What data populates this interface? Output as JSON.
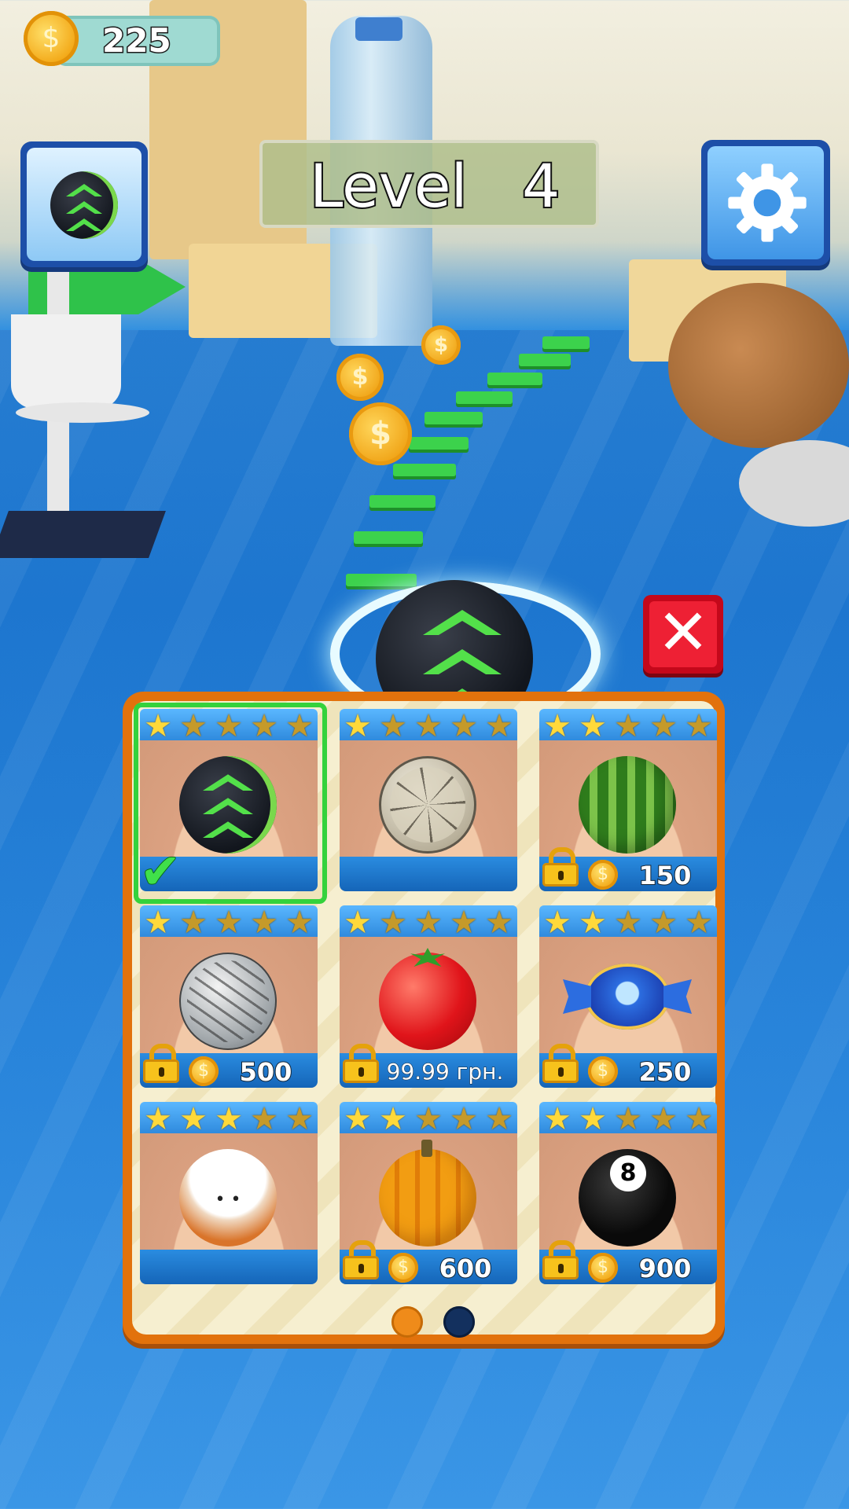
{
  "hud": {
    "coins": "225",
    "level_label": "Level",
    "level_number": "4"
  },
  "icons": {
    "coin": "coin-icon",
    "settings": "gear-icon",
    "close": "close-icon",
    "lock": "lock-icon",
    "check": "checkmark-icon",
    "star": "star-icon"
  },
  "colors": {
    "accent_orange": "#e2720c",
    "selected_green": "#34d23c",
    "close_red": "#ee2034",
    "panel_blue": "#1d4fa8"
  },
  "shop": {
    "page": 1,
    "pages": 2,
    "items": [
      {
        "name": "green-chevron-ball",
        "stars": 1,
        "locked": false,
        "selected": true,
        "price": ""
      },
      {
        "name": "stone-ball",
        "stars": 1,
        "locked": false,
        "selected": false,
        "price": ""
      },
      {
        "name": "watermelon-ball",
        "stars": 2,
        "locked": true,
        "selected": false,
        "price": "150"
      },
      {
        "name": "steel-ball",
        "stars": 1,
        "locked": true,
        "selected": false,
        "price": "500"
      },
      {
        "name": "tomato-ball",
        "stars": 1,
        "locked": true,
        "selected": false,
        "price": "99.99 грн."
      },
      {
        "name": "candy-ball",
        "stars": 2,
        "locked": true,
        "selected": false,
        "price": "250"
      },
      {
        "name": "hamster-ball",
        "stars": 3,
        "locked": false,
        "selected": false,
        "price": ""
      },
      {
        "name": "pumpkin-ball",
        "stars": 2,
        "locked": true,
        "selected": false,
        "price": "600"
      },
      {
        "name": "eight-ball",
        "stars": 2,
        "locked": true,
        "selected": false,
        "price": "900"
      }
    ]
  }
}
